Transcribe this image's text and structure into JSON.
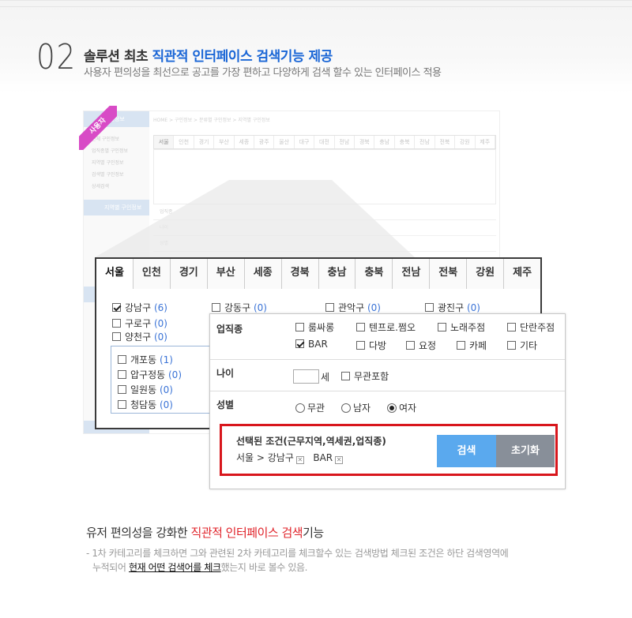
{
  "header": {
    "number": "02",
    "title_prefix": "솔루션 최초 ",
    "title_highlight": "직관적 인터페이스 검색기능 제공",
    "subtitle": "사용자 편의성을 최선으로 공고를 가장 편하고 다양하게 검색 할수 있는 인터페이스 적용"
  },
  "ribbon_label": "사용자",
  "background_shot": {
    "breadcrumb": "HOME > 구인정보 > 분류별 구인정보 > 지역별 구인정보",
    "side_heads": [
      "구인정보",
      "지역별 구인정보",
      "",
      ""
    ],
    "side_items": [
      "전체 구인정보",
      "업직종별 구인정보",
      "지역별 구인정보",
      "검색별 구인정보",
      "상세검색"
    ],
    "tabs": [
      "서울",
      "인천",
      "경기",
      "부산",
      "세종",
      "광주",
      "울산",
      "대구",
      "대전",
      "전남",
      "경북",
      "충남",
      "충북",
      "전남",
      "전북",
      "강원",
      "제주"
    ],
    "rows": [
      "업직종",
      "나이",
      "성별"
    ]
  },
  "region_tabs": [
    "서울",
    "인천",
    "경기",
    "부산",
    "세종",
    "경북",
    "충남",
    "충북",
    "전남",
    "전북",
    "강원",
    "제주"
  ],
  "districts": [
    {
      "name": "강남구",
      "count": "(6)",
      "checked": true
    },
    {
      "name": "강동구",
      "count": "(0)",
      "checked": false
    },
    {
      "name": "관악구",
      "count": "(0)",
      "checked": false
    },
    {
      "name": "광진구",
      "count": "(0)",
      "checked": false
    },
    {
      "name": "구로구",
      "count": "(0)",
      "checked": false
    },
    {
      "name": "양천구",
      "count": "(0)",
      "checked": false
    }
  ],
  "sub_districts": [
    {
      "name": "개포동",
      "count": "(1)"
    },
    {
      "name": "압구정동",
      "count": "(0)"
    },
    {
      "name": "일원동",
      "count": "(0)"
    },
    {
      "name": "청담동",
      "count": "(0)"
    }
  ],
  "filter": {
    "job_label": "업직종",
    "jobs": [
      {
        "name": "룸싸롱",
        "checked": false
      },
      {
        "name": "텐프로.쩜오",
        "checked": false
      },
      {
        "name": "노래주점",
        "checked": false
      },
      {
        "name": "단란주점",
        "checked": false
      },
      {
        "name": "BAR",
        "checked": true
      },
      {
        "name": "다방",
        "checked": false
      },
      {
        "name": "요정",
        "checked": false
      },
      {
        "name": "카페",
        "checked": false
      },
      {
        "name": "기타",
        "checked": false
      }
    ],
    "age_label": "나이",
    "age_unit": "세",
    "age_any": "무관포함",
    "gender_label": "성별",
    "genders": [
      {
        "name": "무관",
        "selected": false
      },
      {
        "name": "남자",
        "selected": false
      },
      {
        "name": "여자",
        "selected": true
      }
    ]
  },
  "selection": {
    "title": "선택된 조건(근무지역,역세권,업직종)",
    "path_region": "서울 > 강남구",
    "tag": "BAR",
    "search_button": "검색",
    "reset_button": "초기화"
  },
  "bottom": {
    "title_prefix": "유저 편의성을 강화한 ",
    "title_highlight": "직관적 인터페이스 검색",
    "title_suffix": "기능",
    "desc_1": "- 1차 카테고리를 체크하면 그와 관련된 2차 카테고리를 체크할수 있는 검색방법 체크된 조건은 하단 검색영역에",
    "desc_2_pre": "누적되어 ",
    "desc_2_em": "현재 어떤 검색어를 체크",
    "desc_2_post": "했는지 바로 볼수 있음."
  },
  "colors": {
    "accent_blue": "#1a66d6",
    "accent_red": "#e0232a",
    "search_btn": "#5aa9ee",
    "reset_btn": "#888f99",
    "ribbon": "#d84bc6"
  }
}
